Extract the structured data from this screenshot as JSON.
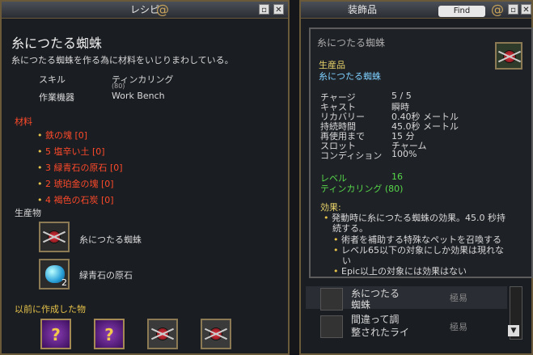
{
  "recipe_window": {
    "title": "レシピ",
    "item_name": "糸につたる蜘蛛",
    "description": "糸につたる蜘蛛を作る為に材料をいじりまわしている。",
    "skill_label": "スキル",
    "skill_value": "ティンカリング",
    "skill_value_sub": "(80)",
    "workstation_label": "作業機器",
    "workstation_value": "Work Bench",
    "materials_heading": "材料",
    "materials": [
      "鉄の塊 [0]",
      "5 塩辛い土 [0]",
      "3 緑青石の原石 [0]",
      "2 琥珀金の塊 [0]",
      "4 褐色の石炭 [0]"
    ],
    "products_heading": "生産物",
    "products": [
      {
        "label": "糸につたる蜘蛛",
        "icon": "spider-icon",
        "count": ""
      },
      {
        "label": "緑青石の原石",
        "icon": "gem-icon",
        "count": "2"
      }
    ],
    "previous_heading": "以前に作成した物",
    "previous_items": [
      "?",
      "?",
      "spider",
      "spider"
    ]
  },
  "ornament_window": {
    "title": "装飾品",
    "find_button": "Find",
    "list_rows": [
      {
        "name_line1": "糸につたる",
        "name_line2": "蜘蛛",
        "difficulty": "極易"
      },
      {
        "name_line1": "間違って調",
        "name_line2": "整されたライ",
        "difficulty": "極易"
      }
    ]
  },
  "tooltip": {
    "title": "糸につたる蜘蛛",
    "category": "生産品",
    "subcategory": "糸につたる蜘蛛",
    "stats": [
      {
        "label": "チャージ",
        "value": "5 / 5"
      },
      {
        "label": "キャスト",
        "value": "瞬時"
      },
      {
        "label": "リカバリー",
        "value": "0.40秒 メートル"
      },
      {
        "label": "持続時間",
        "value": "45.0秒 メートル"
      },
      {
        "label": "再使用まで",
        "value": "15 分"
      },
      {
        "label": "スロット",
        "value": "チャーム"
      },
      {
        "label": "コンディション",
        "value": "100%"
      }
    ],
    "level_label": "レベル",
    "level_value": "16",
    "skill_req": "ティンカリング (80)",
    "effects_heading": "効果:",
    "effect_main_1": "発動時に糸につたる蜘蛛の効果。45.0 秒持",
    "effect_main_2": "続する。",
    "sub_effects": [
      "術者を補助する特殊なペットを召喚する",
      "レベル65以下の対象にしか効果は現れな",
      "い",
      "Epic以上の対象には効果はない"
    ]
  },
  "colors": {
    "material_red": "#ff4a2a",
    "level_green": "#57d84a",
    "category_blue": "#7fd0ff",
    "frame_gold": "#6b5a3a"
  }
}
